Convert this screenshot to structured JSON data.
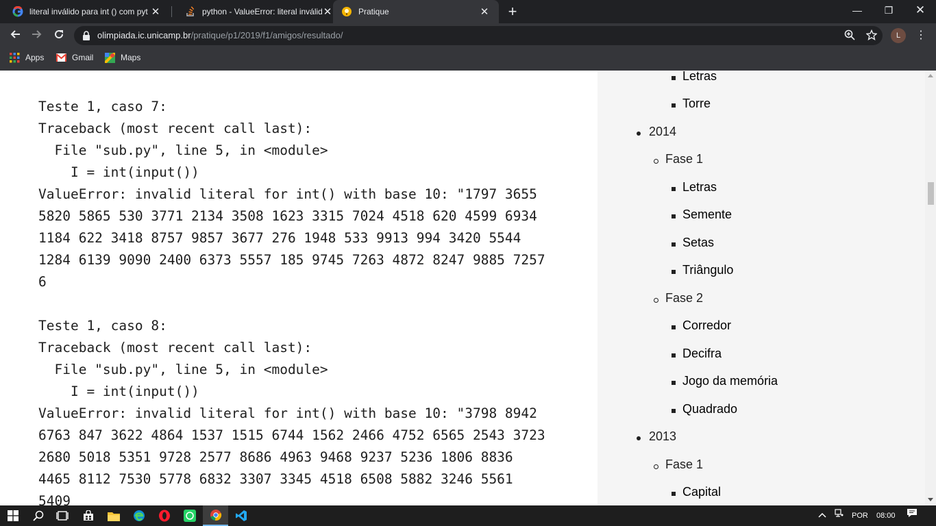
{
  "browser": {
    "tabs": [
      {
        "title": "literal inválido para int () com pyt"
      },
      {
        "title": "python - ValueError: literal inválid"
      },
      {
        "title": "Pratique"
      }
    ],
    "url_domain": "olimpiada.ic.unicamp.br",
    "url_path": "/pratique/p1/2019/f1/amigos/resultado/",
    "avatar_letter": "L",
    "bookmarks": [
      {
        "label": "Apps"
      },
      {
        "label": "Gmail"
      },
      {
        "label": "Maps"
      }
    ]
  },
  "output": {
    "lines": [
      "Teste 1, caso 7:",
      "Traceback (most recent call last):",
      "  File \"sub.py\", line 5, in <module>",
      "    I = int(input())",
      "ValueError: invalid literal for int() with base 10: \"1797 3655",
      "5820 5865 530 3771 2134 3508 1623 3315 7024 4518 620 4599 6934",
      "1184 622 3418 8757 9857 3677 276 1948 533 9913 994 3420 5544",
      "1284 6139 9090 2400 6373 5557 185 9745 7263 4872 8247 9885 7257",
      "6",
      "",
      "Teste 1, caso 8:",
      "Traceback (most recent call last):",
      "  File \"sub.py\", line 5, in <module>",
      "    I = int(input())",
      "ValueError: invalid literal for int() with base 10: \"3798 8942",
      "6763 847 3622 4864 1537 1515 6744 1562 2466 4752 6565 2543 3723",
      "2680 5018 5351 9728 2577 8686 4963 9468 9237 5236 1806 8836",
      "4465 8112 7530 5778 6832 3307 3345 4518 6508 5882 3246 5561",
      "5409"
    ]
  },
  "sidebar": {
    "items": [
      {
        "level": "problem",
        "label": "Letras"
      },
      {
        "level": "problem",
        "label": "Torre"
      },
      {
        "level": "year",
        "label": "2014"
      },
      {
        "level": "fase",
        "label": "Fase 1"
      },
      {
        "level": "problem",
        "label": "Letras"
      },
      {
        "level": "problem",
        "label": "Semente"
      },
      {
        "level": "problem",
        "label": "Setas"
      },
      {
        "level": "problem",
        "label": "Triângulo"
      },
      {
        "level": "fase",
        "label": "Fase 2"
      },
      {
        "level": "problem",
        "label": "Corredor"
      },
      {
        "level": "problem",
        "label": "Decifra"
      },
      {
        "level": "problem",
        "label": "Jogo da memória"
      },
      {
        "level": "problem",
        "label": "Quadrado"
      },
      {
        "level": "year",
        "label": "2013"
      },
      {
        "level": "fase",
        "label": "Fase 1"
      },
      {
        "level": "problem",
        "label": "Capital"
      }
    ]
  },
  "taskbar": {
    "language": "POR",
    "time": "08:00"
  },
  "colors": {
    "link": "#8b0046",
    "chrome_dark": "#202124",
    "chrome_toolbar": "#35363a"
  }
}
